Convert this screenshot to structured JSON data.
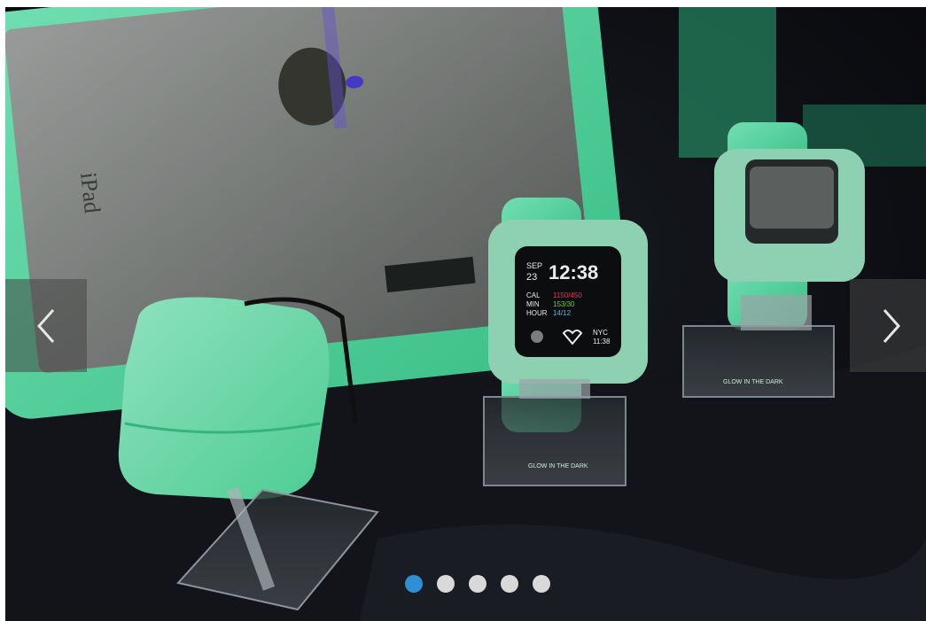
{
  "carousel": {
    "prev_icon": "chevron-left-icon",
    "next_icon": "chevron-right-icon",
    "slide_count": 5,
    "active_slide": 1,
    "slide_alt": "Glow in the dark cases for iPad, AirPods and Apple Watch on display stands"
  },
  "watch_screen": {
    "date_day": "SEP",
    "date_num": "23",
    "time": "12:38",
    "cal_label": "CAL",
    "cal_value": "1150/450",
    "min_label": "MIN",
    "min_value": "153/30",
    "hour_label": "HOUR",
    "hour_value": "14/12",
    "city": "NYC",
    "city_time": "11:38"
  },
  "stand_label": "GLOW IN THE DARK",
  "ipad_label": "iPad",
  "colors": {
    "glow": "#5ee6ad",
    "dot_active": "#2e8fd6",
    "dot_inactive": "#d9d9d9",
    "background": "#0c0d12"
  }
}
